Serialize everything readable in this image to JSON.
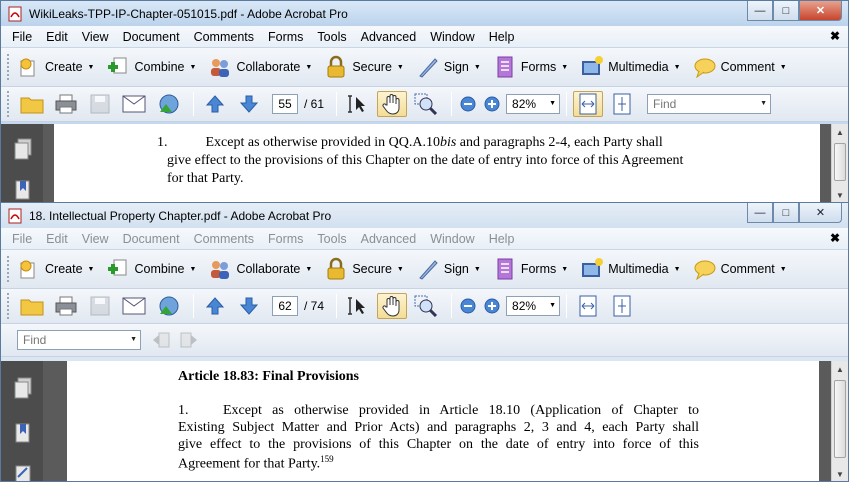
{
  "window1": {
    "title": "WikiLeaks-TPP-IP-Chapter-051015.pdf - Adobe Acrobat Pro",
    "menu": [
      "File",
      "Edit",
      "View",
      "Document",
      "Comments",
      "Forms",
      "Tools",
      "Advanced",
      "Window",
      "Help"
    ],
    "tasks": [
      {
        "label": "Create",
        "icon": "create-icon"
      },
      {
        "label": "Combine",
        "icon": "combine-icon"
      },
      {
        "label": "Collaborate",
        "icon": "collaborate-icon"
      },
      {
        "label": "Secure",
        "icon": "lock-icon"
      },
      {
        "label": "Sign",
        "icon": "pen-icon"
      },
      {
        "label": "Forms",
        "icon": "forms-icon"
      },
      {
        "label": "Multimedia",
        "icon": "multimedia-icon"
      },
      {
        "label": "Comment",
        "icon": "comment-icon"
      }
    ],
    "current_page": "55",
    "total_pages": "/ 61",
    "zoom": "82%",
    "find_placeholder": "Find",
    "doc": {
      "para_number": "1.",
      "line1_before": "Except as otherwise provided in QQ.A.10",
      "line1_italic": "bis",
      "line1_after": " and paragraphs 2-4, each Party shall",
      "line2": "give effect to the provisions of this Chapter on the date of entry into force of this Agreement",
      "line3": "for that Party."
    }
  },
  "window2": {
    "title": "18. Intellectual Property Chapter.pdf - Adobe Acrobat Pro",
    "menu": [
      "File",
      "Edit",
      "View",
      "Document",
      "Comments",
      "Forms",
      "Tools",
      "Advanced",
      "Window",
      "Help"
    ],
    "tasks": [
      {
        "label": "Create",
        "icon": "create-icon"
      },
      {
        "label": "Combine",
        "icon": "combine-icon"
      },
      {
        "label": "Collaborate",
        "icon": "collaborate-icon"
      },
      {
        "label": "Secure",
        "icon": "lock-icon"
      },
      {
        "label": "Sign",
        "icon": "pen-icon"
      },
      {
        "label": "Forms",
        "icon": "forms-icon"
      },
      {
        "label": "Multimedia",
        "icon": "multimedia-icon"
      },
      {
        "label": "Comment",
        "icon": "comment-icon"
      }
    ],
    "current_page": "62",
    "total_pages": "/ 74",
    "zoom": "82%",
    "find_placeholder": "Find",
    "doc": {
      "heading": "Article 18.83: Final Provisions",
      "para_number": "1.",
      "line1": "Except as otherwise provided in Article 18.10 (Application of Chapter to",
      "line2": "Existing Subject Matter and Prior Acts) and paragraphs 2, 3 and 4, each Party shall",
      "line3": "give effect to the provisions of this Chapter on the date of entry into force of this",
      "line4": "Agreement for that Party.",
      "footnote": "159"
    }
  },
  "colors": {
    "active_title": "#bcd3ec",
    "inactive_title": "#d2e0ef",
    "doc_background": "#5b5b5b",
    "close_red": "#c8452e"
  }
}
